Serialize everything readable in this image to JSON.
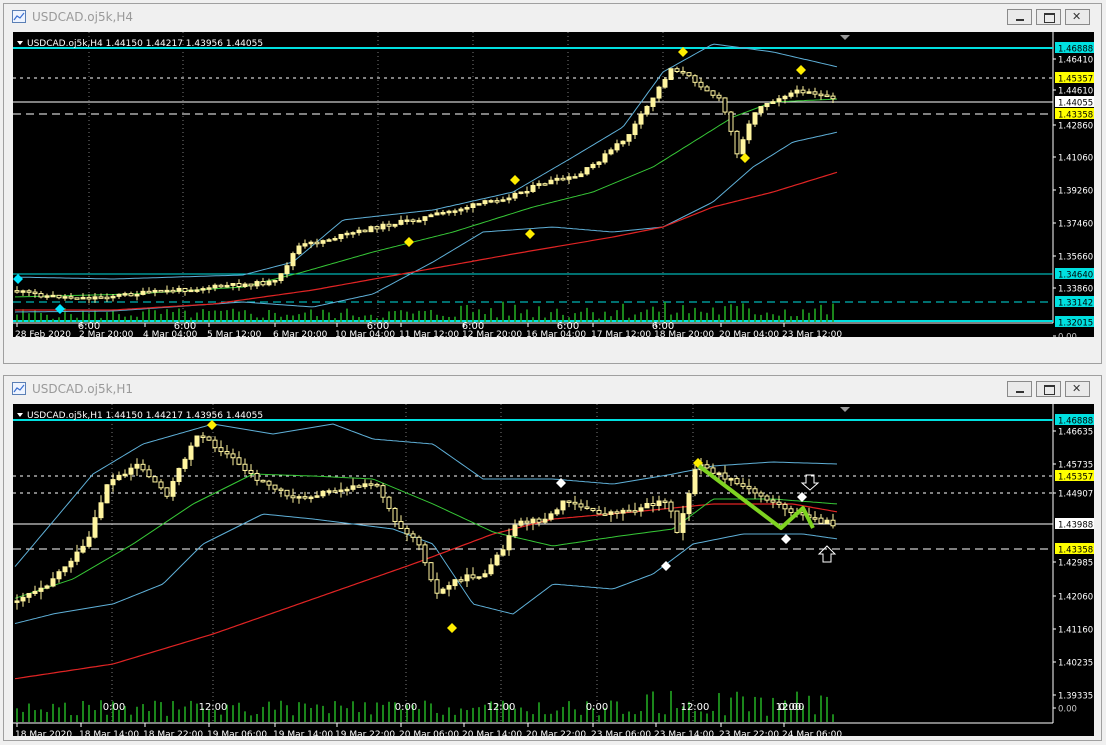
{
  "windows": [
    {
      "title": "USDCAD.oj5k,H4",
      "header": "USDCAD.oj5k,H4  1.44150 1.44217 1.43956 1.44055",
      "price_labels": [
        {
          "text": "1.46888",
          "style": "cyan"
        },
        {
          "text": "1.46410",
          "style": "plain"
        },
        {
          "text": "1.45357",
          "style": "yellow"
        },
        {
          "text": "1.44610",
          "style": "plain"
        },
        {
          "text": "1.44055",
          "style": "white"
        },
        {
          "text": "1.43358",
          "style": "yellow"
        },
        {
          "text": "1.42860",
          "style": "plain"
        },
        {
          "text": "1.41060",
          "style": "plain"
        },
        {
          "text": "1.39260",
          "style": "plain"
        },
        {
          "text": "1.37460",
          "style": "plain"
        },
        {
          "text": "1.35660",
          "style": "plain"
        },
        {
          "text": "1.34640",
          "style": "cyan"
        },
        {
          "text": "1.33860",
          "style": "plain"
        },
        {
          "text": "1.33142",
          "style": "cyan"
        },
        {
          "text": "1.32015",
          "style": "cyan"
        },
        {
          "text": "0.00",
          "style": "dark"
        }
      ],
      "session_labels": [
        "6:00",
        "6:00",
        "6:00",
        "6:00",
        "6:00",
        "6:00"
      ],
      "time_labels": [
        "28 Feb 2020",
        "2 Mar 20:00",
        "4 Mar 04:00",
        "5 Mar 12:00",
        "6 Mar 20:00",
        "10 Mar 04:00",
        "11 Mar 12:00",
        "12 Mar 20:00",
        "16 Mar 04:00",
        "17 Mar 12:00",
        "18 Mar 20:00",
        "20 Mar 04:00",
        "23 Mar 12:00"
      ]
    },
    {
      "title": "USDCAD.oj5k,H1",
      "header": "USDCAD.oj5k,H1  1.44150 1.44217 1.43956 1.44055",
      "price_labels": [
        {
          "text": "1.46888",
          "style": "cyan"
        },
        {
          "text": "1.46635",
          "style": "plain"
        },
        {
          "text": "1.45735",
          "style": "plain"
        },
        {
          "text": "1.45357",
          "style": "yellow"
        },
        {
          "text": "1.44907",
          "style": "plain"
        },
        {
          "text": "1.43988",
          "style": "white"
        },
        {
          "text": "1.43358",
          "style": "yellow"
        },
        {
          "text": "1.42985",
          "style": "plain"
        },
        {
          "text": "1.42060",
          "style": "plain"
        },
        {
          "text": "1.41160",
          "style": "plain"
        },
        {
          "text": "1.40235",
          "style": "plain"
        },
        {
          "text": "1.39335",
          "style": "plain"
        },
        {
          "text": "0.00",
          "style": "dark"
        }
      ],
      "session_labels": [
        "0:00",
        "12:00",
        "0:00",
        "12:00",
        "0:00",
        "12:00",
        "0:00",
        "12:00"
      ],
      "time_labels": [
        "18 Mar 2020",
        "18 Mar 14:00",
        "18 Mar 22:00",
        "19 Mar 06:00",
        "19 Mar 14:00",
        "19 Mar 22:00",
        "20 Mar 06:00",
        "20 Mar 14:00",
        "20 Mar 22:00",
        "23 Mar 06:00",
        "23 Mar 14:00",
        "23 Mar 22:00",
        "24 Mar 06:00"
      ]
    }
  ],
  "window_buttons": [
    "minimize",
    "restore",
    "close"
  ],
  "colors": {
    "background": "#000000",
    "candle": "#fff5a0",
    "bollinger": "#5fb0d8",
    "middle_band": "#37c837",
    "moving_average": "#e02424",
    "volume": "#22a822",
    "level_cyan": "#00e0e0",
    "level_yellow": "#ffff00",
    "arrow_line": "#7ed321",
    "fractal_yellow": "#ffee00",
    "fractal_white": "#ffffff"
  }
}
